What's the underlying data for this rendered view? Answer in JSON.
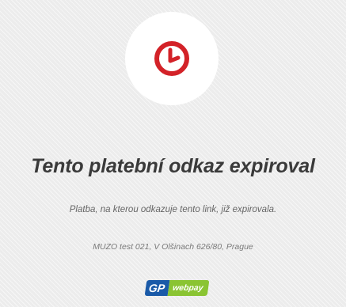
{
  "status_icon": {
    "name": "expired-clock-icon",
    "color": "#d32228"
  },
  "title": "Tento platební odkaz expiroval",
  "message": "Platba, na kterou odkazuje tento link, již expirovala.",
  "merchant_info": "MUZO test 021, V Olšinach 626/80, Prague",
  "logo": {
    "gp_text": "GP",
    "webpay_text": "webpay",
    "gp_color": "#1a5aa8",
    "webpay_color": "#8ac432"
  }
}
